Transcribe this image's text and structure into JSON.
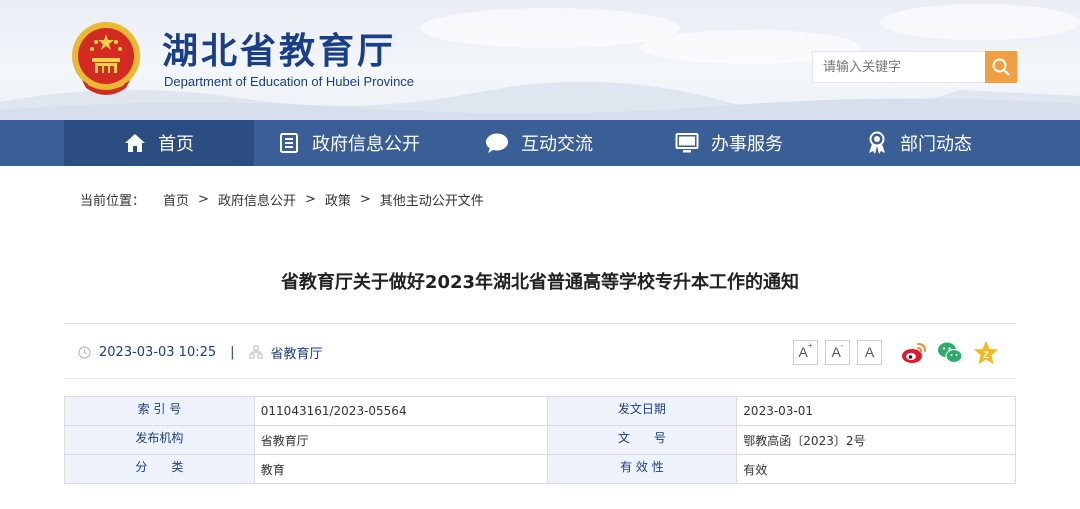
{
  "header": {
    "title": "湖北省教育厅",
    "subtitle": "Department of Education of Hubei Province",
    "search_placeholder": "请输入关键字"
  },
  "nav": {
    "items": [
      {
        "label": "首页",
        "icon": "home-icon"
      },
      {
        "label": "政府信息公开",
        "icon": "document-icon"
      },
      {
        "label": "互动交流",
        "icon": "chat-icon"
      },
      {
        "label": "办事服务",
        "icon": "monitor-icon"
      },
      {
        "label": "部门动态",
        "icon": "award-icon"
      }
    ]
  },
  "breadcrumb": {
    "prefix": "当前位置：",
    "items": [
      "首页",
      "政府信息公开",
      "政策",
      "其他主动公开文件"
    ],
    "separator": ">"
  },
  "article": {
    "title": "省教育厅关于做好2023年湖北省普通高等学校专升本工作的通知",
    "datetime": "2023-03-03 10:25",
    "separator": "|",
    "source": "省教育厅",
    "font_buttons": [
      "A",
      "A",
      "A"
    ]
  },
  "info_table": {
    "rows": [
      {
        "label1": "索 引 号",
        "value1": "011043161/2023-05564",
        "label2": "发文日期",
        "value2": "2023-03-01"
      },
      {
        "label1": "发布机构",
        "value1": "省教育厅",
        "label2": "文　　号",
        "value2": "鄂教高函〔2023〕2号"
      },
      {
        "label1": "分　　类",
        "value1": "教育",
        "label2": "有 效 性",
        "value2": "有效"
      }
    ]
  },
  "colors": {
    "nav_bg": "#3a5f97",
    "nav_active": "#2c4d82",
    "brand_blue": "#1a3f86",
    "search_button": "#f0a040",
    "table_label_bg": "#eef3fb"
  }
}
